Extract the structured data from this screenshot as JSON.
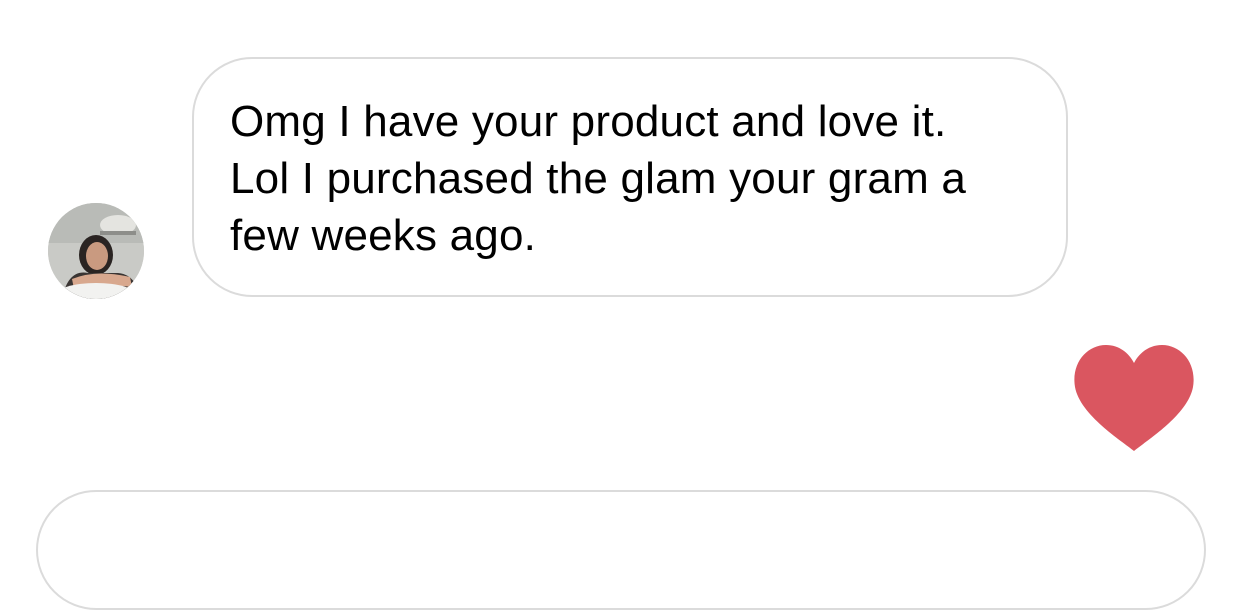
{
  "thread": {
    "incoming_message": {
      "text": "Omg I have your product and love it.\nLol I purchased the glam your gram a\nfew weeks ago."
    },
    "reaction": {
      "icon": "heart-icon",
      "color": "#da5660"
    }
  },
  "composer": {
    "placeholder": ""
  },
  "colors": {
    "bubble_border": "#dbdbdb",
    "background": "#ffffff",
    "text": "#000000"
  }
}
